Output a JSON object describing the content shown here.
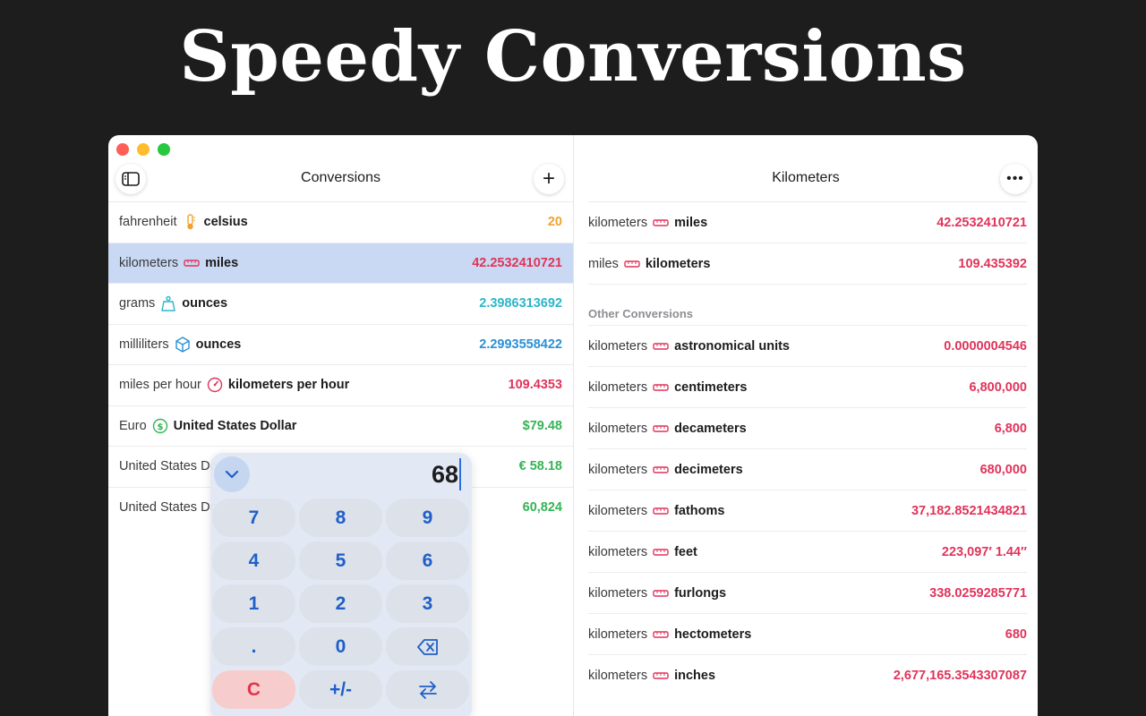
{
  "hero": {
    "title": "Speedy Conversions"
  },
  "left": {
    "title": "Conversions",
    "add_label": "+",
    "rows": [
      {
        "from": "fahrenheit",
        "to": "celsius",
        "value": "20",
        "icon": "thermometer-icon",
        "color": "#f0a22e"
      },
      {
        "from": "kilometers",
        "to": "miles",
        "value": "42.2532410721",
        "icon": "ruler-icon",
        "color": "#e0345a"
      },
      {
        "from": "grams",
        "to": "ounces",
        "value": "2.3986313692",
        "icon": "weight-icon",
        "color": "#2bb6c8"
      },
      {
        "from": "milliliters",
        "to": "ounces",
        "value": "2.2993558422",
        "icon": "cube-icon",
        "color": "#2b8fd6"
      },
      {
        "from": "miles per hour",
        "to": "kilometers per hour",
        "value": "109.4353",
        "icon": "speedometer-icon",
        "color": "#e0345a"
      },
      {
        "from": "Euro",
        "to": "United States Dollar",
        "value": "$79.48",
        "icon": "currency-icon",
        "color": "#34b455"
      },
      {
        "from": "United States Do",
        "to": "",
        "value": "€ 58.18",
        "icon": "",
        "color": "#34b455"
      },
      {
        "from": "United States Do",
        "to": "",
        "value": "60,824",
        "icon": "",
        "color": "#34b455"
      }
    ]
  },
  "right": {
    "title": "Kilometers",
    "more_label": "•••",
    "top_rows": [
      {
        "from": "kilometers",
        "to": "miles",
        "value": "42.2532410721"
      },
      {
        "from": "miles",
        "to": "kilometers",
        "value": "109.435392"
      }
    ],
    "section_title": "Other Conversions",
    "other_rows": [
      {
        "from": "kilometers",
        "to": "astronomical units",
        "value": "0.0000004546"
      },
      {
        "from": "kilometers",
        "to": "centimeters",
        "value": "6,800,000"
      },
      {
        "from": "kilometers",
        "to": "decameters",
        "value": "6,800"
      },
      {
        "from": "kilometers",
        "to": "decimeters",
        "value": "680,000"
      },
      {
        "from": "kilometers",
        "to": "fathoms",
        "value": "37,182.8521434821"
      },
      {
        "from": "kilometers",
        "to": "feet",
        "value": "223,097′ 1.44″"
      },
      {
        "from": "kilometers",
        "to": "furlongs",
        "value": "338.0259285771"
      },
      {
        "from": "kilometers",
        "to": "hectometers",
        "value": "680"
      },
      {
        "from": "kilometers",
        "to": "inches",
        "value": "2,677,165.3543307087"
      }
    ]
  },
  "keypad": {
    "display": "68",
    "keys": [
      "7",
      "8",
      "9",
      "4",
      "5",
      "6",
      "1",
      "2",
      "3",
      ".",
      "0",
      "⌫",
      "C",
      "+/-",
      "⇆"
    ]
  },
  "colors": {
    "accent_red": "#e0345a",
    "accent_orange": "#f0a22e",
    "accent_teal": "#2bb6c8",
    "accent_blue": "#2b8fd6",
    "accent_green": "#34b455",
    "selection": "#c9d9f3",
    "key_blue": "#1f5fc7"
  }
}
